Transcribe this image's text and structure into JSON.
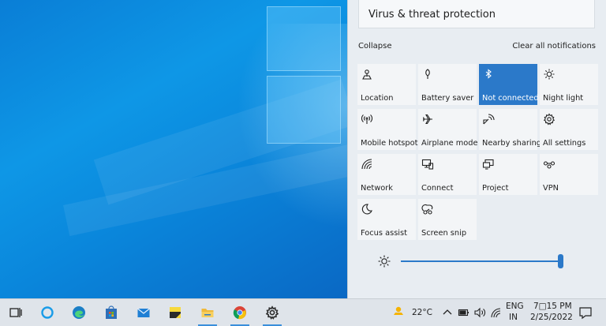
{
  "notification": {
    "title": "Virus & threat protection"
  },
  "action_center": {
    "collapse_label": "Collapse",
    "clear_all_label": "Clear all notifications",
    "tiles": [
      {
        "label": "Location",
        "icon": "location-icon",
        "active": false
      },
      {
        "label": "Battery saver",
        "icon": "battery-saver-icon",
        "active": false
      },
      {
        "label": "Not connected",
        "icon": "bluetooth-icon",
        "active": true
      },
      {
        "label": "Night light",
        "icon": "night-light-icon",
        "active": false
      },
      {
        "label": "Mobile hotspot",
        "icon": "mobile-hotspot-icon",
        "active": false
      },
      {
        "label": "Airplane mode",
        "icon": "airplane-icon",
        "active": false
      },
      {
        "label": "Nearby sharing",
        "icon": "nearby-sharing-icon",
        "active": false
      },
      {
        "label": "All settings",
        "icon": "gear-icon",
        "active": false
      },
      {
        "label": "Network",
        "icon": "network-icon",
        "active": false
      },
      {
        "label": "Connect",
        "icon": "connect-icon",
        "active": false
      },
      {
        "label": "Project",
        "icon": "project-icon",
        "active": false
      },
      {
        "label": "VPN",
        "icon": "vpn-icon",
        "active": false
      },
      {
        "label": "Focus assist",
        "icon": "moon-icon",
        "active": false
      },
      {
        "label": "Screen snip",
        "icon": "screen-snip-icon",
        "active": false
      }
    ],
    "brightness_percent": 100,
    "accent_color": "#2b79c9"
  },
  "taskbar": {
    "apps": [
      "task-view-icon",
      "cortana-icon",
      "edge-icon",
      "store-icon",
      "mail-icon",
      "sticky-notes-icon",
      "file-explorer-icon",
      "chrome-icon",
      "settings-icon"
    ],
    "weather": "22°C",
    "language_line1": "ENG",
    "language_line2": "IN",
    "time": "7□15 PM",
    "date": "2/25/2022"
  }
}
